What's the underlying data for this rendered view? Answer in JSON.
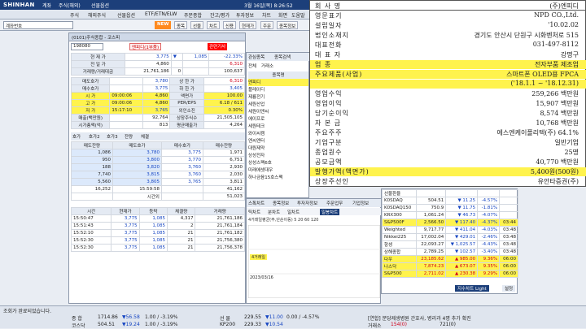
{
  "topbar": {
    "logo": "SHINHAN",
    "tabs": [
      "계좌",
      "주식(해외)",
      "선물옵션"
    ],
    "clock": "3월 16일(목) 8:26:52"
  },
  "menu": [
    "주식",
    "해외주식",
    "선물옵션",
    "ETF/ETN/ELW",
    "주문종합",
    "잔고/평가",
    "투자정보",
    "차트",
    "화면",
    "도움말"
  ],
  "toolbar": {
    "search_value": "계좌번호",
    "new_label": "NEW",
    "buttons": [
      "종목",
      "선물",
      "차트",
      "신용",
      "현재가",
      "주문",
      "종목정보",
      "ETF",
      "연결",
      "차트"
    ]
  },
  "stock_window": {
    "title": "(0101)주식종합 - 코스피",
    "code": "198080",
    "name": "엔피디(1부품)",
    "tags": [
      "엔피디(1부품)",
      "관련기사"
    ],
    "price_rows": [
      {
        "label": "현 재 가",
        "value": "3,775",
        "arrow": "▼",
        "diff": "1,085",
        "pct": "-22.33%"
      },
      {
        "label": "전 일 가",
        "value": "4,860",
        "note": "",
        "v2": "",
        "v3": "6,310"
      },
      {
        "label": "거래량/거래대금",
        "value": "21,761,186",
        "v2": "0",
        "v3": "100,637"
      }
    ],
    "quote_rows": [
      {
        "label": "매도호가",
        "a": "3,780",
        "b": "상 한 가",
        "c": "6,310"
      },
      {
        "label": "매수호가",
        "a": "3,775",
        "b": "하 한 가",
        "c": "3,405"
      },
      {
        "label": "시 가",
        "t": "09:00:06",
        "a": "4,860",
        "b": "액면가",
        "c": "100.00"
      },
      {
        "label": "고 가",
        "t": "09:00:06",
        "a": "4,860",
        "b": "PER/EPS",
        "c": "6.18 / 611"
      },
      {
        "label": "저 가",
        "t": "15:17:10",
        "a": "3,765",
        "b": "외인소진",
        "c": "0.30%"
      },
      {
        "label": "매출(백만원)",
        "a": "92,764",
        "b": "상장주식수",
        "c": "21,505,105"
      },
      {
        "label": "시가총액(억)",
        "a": "813",
        "b": "평균매출가",
        "c": "4,264"
      }
    ],
    "orderbook_tabs": [
      "호가",
      "호가2",
      "호가3",
      "잔량",
      "체결"
    ],
    "orderbook_headers": [
      "매도잔량",
      "매도호가",
      "매수호가",
      "매수잔량"
    ],
    "orderbook": [
      {
        "a": "1,086",
        "b": "3,780",
        "c": "3,775",
        "d": "1,971"
      },
      {
        "a": "950",
        "b": "3,800",
        "c": "3,770",
        "d": "6,751"
      },
      {
        "a": "188",
        "b": "3,820",
        "c": "3,760",
        "d": "2,930"
      },
      {
        "a": "7,740",
        "b": "3,815",
        "c": "3,760",
        "d": "2,030"
      },
      {
        "a": "5,560",
        "b": "3,805",
        "c": "3,765",
        "d": "3,811"
      },
      {
        "a": "16,252",
        "b": "15:59:58",
        "c": "",
        "d": "41,162"
      },
      {
        "a": "",
        "b": "시간외",
        "c": "",
        "d": "51,023"
      }
    ],
    "trade_headers": [
      "시간",
      "현재가",
      "등락",
      "체결량",
      "거래량"
    ],
    "trades": [
      {
        "t": "15:50:47",
        "p": "3,775",
        "d": "1,085",
        "q": "4,317",
        "v": "21,761,186"
      },
      {
        "t": "15:51:43",
        "p": "3,775",
        "d": "1,085",
        "q": "2",
        "v": "21,761,184"
      },
      {
        "t": "15:52:10",
        "p": "3,775",
        "d": "1,085",
        "q": "21",
        "v": "21,761,182"
      },
      {
        "t": "15:52:30",
        "p": "3,775",
        "d": "1,085",
        "q": "21",
        "v": "21,756,380"
      },
      {
        "t": "15:52:30",
        "p": "3,775",
        "d": "1,085",
        "q": "21",
        "v": "21,756,378"
      }
    ]
  },
  "side_list": {
    "title": "관심종목",
    "tabs": [
      "관심종목",
      "종목검색",
      "최근"
    ],
    "radio": [
      "전체",
      "거래소",
      "코스닥"
    ],
    "items": [
      "종목명",
      "엔피디",
      "플레이디",
      "제룡전기",
      "세원산업",
      "세원이앤씨",
      "에이프로",
      "세원테크",
      "와이씨켐",
      "엔씨엔터",
      "대원제약",
      "상성전자",
      "상성스팩6호",
      "미래에셋대우",
      "하나금융15호스팩"
    ]
  },
  "chart_window": {
    "tabs": [
      "스톡차트",
      "종목정보",
      "투자자정보",
      "주문업무",
      "기업정보"
    ],
    "subtabs": [
      "틱차트",
      "분차트",
      "일차트",
      "일봉차트",
      "일봉차트"
    ],
    "legend": "4거래일평균(주,단순이동) 5 20 60 120",
    "date": "2023/03/16",
    "marker": "4거래일"
  },
  "overlay": {
    "rows": [
      {
        "k": "회 사 명",
        "v": "(주)엔피디"
      },
      {
        "k": "영문표기",
        "v": "NPD CO.,Ltd."
      },
      {
        "k": "설립일자",
        "v": "'10.02.02"
      },
      {
        "k": "법인소재지",
        "v": "경기도 안산시 단원구 시화벤처로 515"
      },
      {
        "k": "대표전화",
        "v": "031-497-8112"
      },
      {
        "k": "대 표 자",
        "v": "강명구"
      },
      {
        "k": "업 종",
        "v": "전자부품 제조업",
        "hl": true
      },
      {
        "k": "주요제품(사업)",
        "v": "스마트폰 OLED용 FPCA",
        "hl": true
      },
      {
        "k": "",
        "v": "('18.1.1 ~ '18.12.31)",
        "hl": true
      },
      {
        "k": "영업수익",
        "v": "259,266 백만원"
      },
      {
        "k": "영업이익",
        "v": "15,907 백만원"
      },
      {
        "k": "당기순이익",
        "v": "8,574 백만원"
      },
      {
        "k": "자 본 금",
        "v": "10,768 백만원"
      },
      {
        "k": "주요주주",
        "v": "에스엔케이폴리텍(주) 64.1%"
      },
      {
        "k": "기업구분",
        "v": "일반기업"
      },
      {
        "k": "종업원수",
        "v": "25명"
      },
      {
        "k": "공모금액",
        "v": "40,770 백만원"
      },
      {
        "k": "발행가액(액면가)",
        "v": "5,400원(500원)",
        "hl": true
      },
      {
        "k": "상장주선인",
        "v": "유안타증권(주)"
      }
    ]
  },
  "futures_panel": {
    "title": "선물",
    "rows": [
      {
        "n": "선물환율",
        "a": "",
        "b": "",
        "c": "",
        "d": ""
      },
      {
        "n": "K0SDAQ",
        "a": "504.51",
        "b": "▼ 11.25",
        "c": "-4.57%",
        "d": ""
      },
      {
        "n": "K0SDAQ150",
        "a": "750.9",
        "b": "▼ 11.75",
        "c": "-1.81%",
        "d": ""
      },
      {
        "n": "KRX300",
        "a": "1,061.24",
        "b": "▼ 46.73",
        "c": "-4.07%",
        "d": ""
      },
      {
        "n": "S&P500F",
        "a": "2,566.50",
        "b": "▼ 117.40",
        "c": "-4.37%",
        "d": "03:44",
        "hl": true
      },
      {
        "n": "Weighted",
        "a": "9,717.77",
        "b": "▼ 411.04",
        "c": "-4.03%",
        "d": "03:48"
      },
      {
        "n": "Nikkei225",
        "a": "17,002.04",
        "b": "▼ 429.01",
        "c": "-2.46%",
        "d": "03:48"
      },
      {
        "n": "항셍",
        "a": "22,093.27",
        "b": "▼ 1,025.57",
        "c": "-4.43%",
        "d": "03:48"
      },
      {
        "n": "상해종합",
        "a": "2,789.25",
        "b": "▼ 102.57",
        "c": "-3.40%",
        "d": "03:48"
      },
      {
        "n": "다우",
        "a": "23,185.62",
        "b": "▲ 985.00",
        "c": "9.36%",
        "d": "06:00",
        "hl": true
      },
      {
        "n": "나스닥",
        "a": "7,874.23",
        "b": "▲ 673.07",
        "c": "9.35%",
        "d": "06:00",
        "hl": true
      },
      {
        "n": "S&P500",
        "a": "2,711.02",
        "b": "▲ 230.38",
        "c": "9.29%",
        "d": "06:00",
        "hl": true
      }
    ],
    "footer_button": "지수차트 Light",
    "settings_button": "설정"
  },
  "status": {
    "msg": "조회가 완료되었습니다.",
    "kospi_label": "종 합",
    "kospi": "1714.86",
    "kospi_chg": "▼56.58",
    "kospi_pct": "1.00 / -3.19%",
    "kosdaq_label": "코스닥",
    "kosdaq": "504.51",
    "kosdaq_chg": "▼19.24",
    "kosdaq_pct": "1.00 / -3.19%",
    "fut_label": "선 물",
    "fut": "229.55",
    "fut_chg": "▼11.00",
    "fut_pct": "0.00 / -4.57%",
    "kp_label": "KP200",
    "kp": "229.33",
    "kp_chg": "▼10.54",
    "news": "[연합] 분당제생병원 간호사, 병리과 4명 추가 확진",
    "trade_label": "거래소",
    "trade_val": "154(0)",
    "trade_val2": "721(0)"
  }
}
